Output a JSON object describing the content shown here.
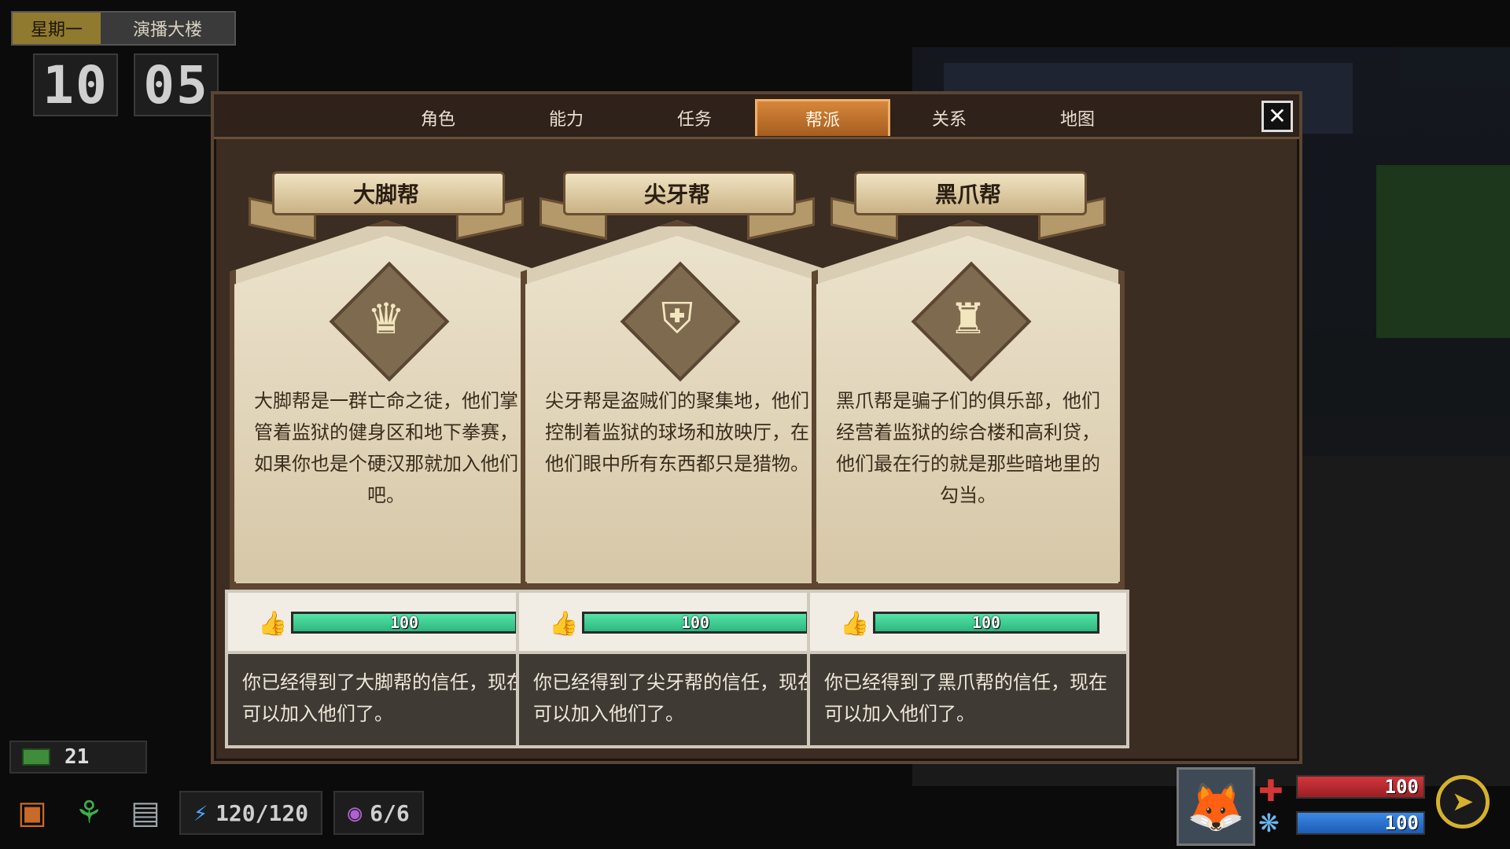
{
  "clock": {
    "day": "星期一",
    "location": "演播大楼",
    "hour": "10",
    "minute": "05"
  },
  "tabs": [
    {
      "label": "角色",
      "active": false
    },
    {
      "label": "能力",
      "active": false
    },
    {
      "label": "任务",
      "active": false
    },
    {
      "label": "帮派",
      "active": true
    },
    {
      "label": "关系",
      "active": false
    },
    {
      "label": "地图",
      "active": false
    }
  ],
  "close_label": "✕",
  "gangs": [
    {
      "name": "大脚帮",
      "emblem": "crown-hand-icon",
      "emblem_glyph": "♛",
      "description": "大脚帮是一群亡命之徒，他们掌管着监狱的健身区和地下拳赛，如果你也是个硬汉那就加入他们吧。",
      "trust": 100,
      "trust_label": "100",
      "status": "你已经得到了大脚帮的信任，现在可以加入他们了。"
    },
    {
      "name": "尖牙帮",
      "emblem": "fang-shield-icon",
      "emblem_glyph": "⛨",
      "description": "尖牙帮是盗贼们的聚集地，他们控制着监狱的球场和放映厅，在他们眼中所有东西都只是猎物。",
      "trust": 100,
      "trust_label": "100",
      "status": "你已经得到了尖牙帮的信任，现在可以加入他们了。"
    },
    {
      "name": "黑爪帮",
      "emblem": "claw-paw-icon",
      "emblem_glyph": "♜",
      "description": "黑爪帮是骗子们的俱乐部，他们经营着监狱的综合楼和高利贷，他们最在行的就是那些暗地里的勾当。",
      "trust": 100,
      "trust_label": "100",
      "status": "你已经得到了黑爪帮的信任，现在可以加入他们了。"
    }
  ],
  "hud": {
    "money": "21",
    "energy": "120/120",
    "vision": "6/6",
    "health": "100",
    "health_pct": 100,
    "mind": "100",
    "mind_pct": 100
  },
  "colors": {
    "trust_bar": "#2cb77e",
    "tab_active": "#c0702c",
    "health": "#d2353b",
    "mind": "#3b8ae6"
  }
}
